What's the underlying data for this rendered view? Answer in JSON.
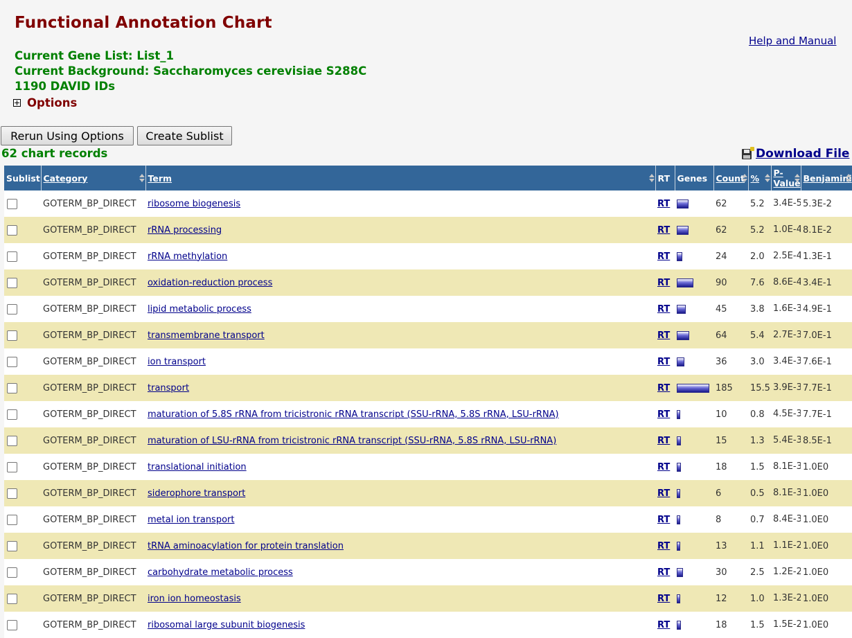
{
  "page": {
    "title": "Functional Annotation Chart",
    "help_link": "Help and Manual",
    "gene_list": "Current Gene List: List_1",
    "background": "Current Background: Saccharomyces cerevisiae S288C",
    "ids": "1190 DAVID IDs",
    "options_label": "Options",
    "rerun_button": "Rerun Using Options",
    "sublist_button": "Create Sublist",
    "records": "62 chart records",
    "download": "Download File"
  },
  "table": {
    "headers": {
      "sublist": "Sublist",
      "category": "Category",
      "term": "Term",
      "rt": "RT",
      "genes": "Genes",
      "count": "Count",
      "percent": "%",
      "pvalue": "P-Value",
      "benjamini": "Benjamini"
    },
    "rows": [
      {
        "category": "GOTERM_BP_DIRECT",
        "term": "ribosome biogenesis",
        "rt": "RT",
        "count": "62",
        "percent": "5.2",
        "pvalue": "3.4E-5",
        "benjamini": "5.3E-2"
      },
      {
        "category": "GOTERM_BP_DIRECT",
        "term": "rRNA processing",
        "rt": "RT",
        "count": "62",
        "percent": "5.2",
        "pvalue": "1.0E-4",
        "benjamini": "8.1E-2"
      },
      {
        "category": "GOTERM_BP_DIRECT",
        "term": "rRNA methylation",
        "rt": "RT",
        "count": "24",
        "percent": "2.0",
        "pvalue": "2.5E-4",
        "benjamini": "1.3E-1"
      },
      {
        "category": "GOTERM_BP_DIRECT",
        "term": "oxidation-reduction process",
        "rt": "RT",
        "count": "90",
        "percent": "7.6",
        "pvalue": "8.6E-4",
        "benjamini": "3.4E-1"
      },
      {
        "category": "GOTERM_BP_DIRECT",
        "term": "lipid metabolic process",
        "rt": "RT",
        "count": "45",
        "percent": "3.8",
        "pvalue": "1.6E-3",
        "benjamini": "4.9E-1"
      },
      {
        "category": "GOTERM_BP_DIRECT",
        "term": "transmembrane transport",
        "rt": "RT",
        "count": "64",
        "percent": "5.4",
        "pvalue": "2.7E-3",
        "benjamini": "7.0E-1"
      },
      {
        "category": "GOTERM_BP_DIRECT",
        "term": "ion transport",
        "rt": "RT",
        "count": "36",
        "percent": "3.0",
        "pvalue": "3.4E-3",
        "benjamini": "7.6E-1"
      },
      {
        "category": "GOTERM_BP_DIRECT",
        "term": "transport",
        "rt": "RT",
        "count": "185",
        "percent": "15.5",
        "pvalue": "3.9E-3",
        "benjamini": "7.7E-1"
      },
      {
        "category": "GOTERM_BP_DIRECT",
        "term": "maturation of 5.8S rRNA from tricistronic rRNA transcript (SSU-rRNA, 5.8S rRNA, LSU-rRNA)",
        "rt": "RT",
        "count": "10",
        "percent": "0.8",
        "pvalue": "4.5E-3",
        "benjamini": "7.7E-1"
      },
      {
        "category": "GOTERM_BP_DIRECT",
        "term": "maturation of LSU-rRNA from tricistronic rRNA transcript (SSU-rRNA, 5.8S rRNA, LSU-rRNA)",
        "rt": "RT",
        "count": "15",
        "percent": "1.3",
        "pvalue": "5.4E-3",
        "benjamini": "8.5E-1"
      },
      {
        "category": "GOTERM_BP_DIRECT",
        "term": "translational initiation",
        "rt": "RT",
        "count": "18",
        "percent": "1.5",
        "pvalue": "8.1E-3",
        "benjamini": "1.0E0"
      },
      {
        "category": "GOTERM_BP_DIRECT",
        "term": "siderophore transport",
        "rt": "RT",
        "count": "6",
        "percent": "0.5",
        "pvalue": "8.1E-3",
        "benjamini": "1.0E0"
      },
      {
        "category": "GOTERM_BP_DIRECT",
        "term": "metal ion transport",
        "rt": "RT",
        "count": "8",
        "percent": "0.7",
        "pvalue": "8.4E-3",
        "benjamini": "1.0E0"
      },
      {
        "category": "GOTERM_BP_DIRECT",
        "term": "tRNA aminoacylation for protein translation",
        "rt": "RT",
        "count": "13",
        "percent": "1.1",
        "pvalue": "1.1E-2",
        "benjamini": "1.0E0"
      },
      {
        "category": "GOTERM_BP_DIRECT",
        "term": "carbohydrate metabolic process",
        "rt": "RT",
        "count": "30",
        "percent": "2.5",
        "pvalue": "1.2E-2",
        "benjamini": "1.0E0"
      },
      {
        "category": "GOTERM_BP_DIRECT",
        "term": "iron ion homeostasis",
        "rt": "RT",
        "count": "12",
        "percent": "1.0",
        "pvalue": "1.3E-2",
        "benjamini": "1.0E0"
      },
      {
        "category": "GOTERM_BP_DIRECT",
        "term": "ribosomal large subunit biogenesis",
        "rt": "RT",
        "count": "18",
        "percent": "1.5",
        "pvalue": "1.5E-2",
        "benjamini": "1.0E0"
      }
    ]
  }
}
